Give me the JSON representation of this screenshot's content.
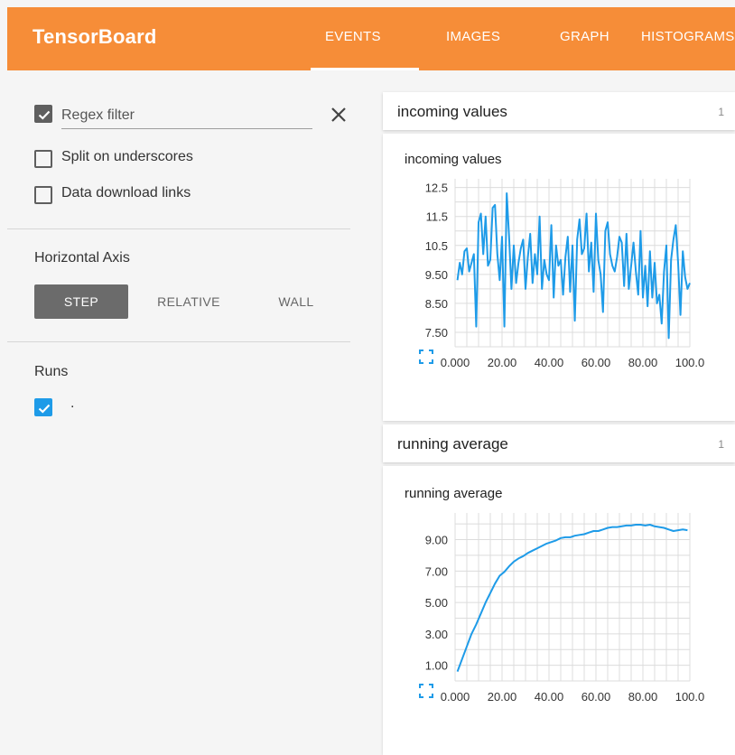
{
  "app": {
    "title": "TensorBoard",
    "tabs": [
      {
        "label": "EVENTS",
        "active": true
      },
      {
        "label": "IMAGES",
        "active": false
      },
      {
        "label": "GRAPH",
        "active": false
      },
      {
        "label": "HISTOGRAMS",
        "active": false
      }
    ],
    "accent_color": "#f68d38"
  },
  "sidebar": {
    "regex_filter": {
      "checked": true,
      "placeholder": "Regex filter",
      "value": ""
    },
    "split_underscores": {
      "label": "Split on underscores",
      "checked": false
    },
    "data_download": {
      "label": "Data download links",
      "checked": false
    },
    "horizontal_axis": {
      "title": "Horizontal Axis",
      "options": [
        "STEP",
        "RELATIVE",
        "WALL"
      ],
      "selected": "STEP"
    },
    "runs": {
      "title": "Runs",
      "items": [
        {
          "label": ".",
          "checked": true,
          "color": "#1e9be8"
        }
      ]
    }
  },
  "cards": [
    {
      "header": "incoming values",
      "count": "1",
      "chart_title": "incoming values"
    },
    {
      "header": "running average",
      "count": "1",
      "chart_title": "running average"
    }
  ],
  "chart_data": [
    {
      "type": "line",
      "title": "incoming values",
      "xlabel": "",
      "ylabel": "",
      "xlim": [
        0,
        100
      ],
      "ylim": [
        7.0,
        12.8
      ],
      "xticks": [
        "0.000",
        "20.00",
        "40.00",
        "60.00",
        "80.00",
        "100.0"
      ],
      "yticks": [
        "7.50",
        "8.50",
        "9.50",
        "10.5",
        "11.5",
        "12.5"
      ],
      "ytick_values": [
        7.5,
        8.5,
        9.5,
        10.5,
        11.5,
        12.5
      ],
      "grid": true,
      "series": [
        {
          "color": "#1e9be8",
          "x": [
            1,
            2,
            3,
            4,
            5,
            6,
            7,
            8,
            9,
            10,
            11,
            12,
            13,
            14,
            15,
            16,
            17,
            18,
            19,
            20,
            21,
            22,
            23,
            24,
            25,
            26,
            27,
            28,
            29,
            30,
            31,
            32,
            33,
            34,
            35,
            36,
            37,
            38,
            39,
            40,
            41,
            42,
            43,
            44,
            45,
            46,
            47,
            48,
            49,
            50,
            51,
            52,
            53,
            54,
            55,
            56,
            57,
            58,
            59,
            60,
            61,
            62,
            63,
            64,
            65,
            66,
            67,
            68,
            69,
            70,
            71,
            72,
            73,
            74,
            75,
            76,
            77,
            78,
            79,
            80,
            81,
            82,
            83,
            84,
            85,
            86,
            87,
            88,
            89,
            90,
            91,
            92,
            93,
            94,
            95,
            96,
            97,
            98,
            99,
            100
          ],
          "y": [
            9.3,
            9.9,
            9.5,
            10.3,
            10.4,
            9.6,
            9.9,
            10.2,
            7.7,
            11.3,
            11.6,
            10.2,
            11.5,
            9.8,
            10.0,
            11.8,
            11.9,
            10.2,
            9.3,
            10.8,
            7.7,
            12.3,
            10.8,
            9.0,
            10.5,
            9.2,
            9.9,
            10.4,
            10.7,
            9.0,
            10.1,
            10.9,
            9.2,
            10.2,
            9.5,
            11.5,
            9.0,
            10.0,
            9.5,
            9.3,
            11.2,
            8.7,
            10.5,
            9.8,
            10.0,
            8.8,
            10.1,
            10.8,
            8.9,
            10.5,
            7.9,
            10.7,
            11.4,
            10.2,
            10.4,
            11.6,
            9.6,
            10.6,
            8.9,
            11.6,
            10.0,
            9.5,
            8.2,
            11.0,
            11.3,
            10.2,
            9.8,
            9.6,
            10.1,
            10.8,
            10.6,
            9.1,
            10.9,
            9.0,
            9.8,
            10.6,
            9.6,
            8.8,
            11.0,
            8.7,
            9.8,
            8.4,
            10.3,
            8.7,
            9.9,
            8.5,
            8.8,
            7.8,
            9.6,
            10.5,
            7.3,
            10.0,
            10.7,
            11.2,
            9.9,
            8.1,
            10.3,
            9.4,
            9.0,
            9.2
          ]
        }
      ]
    },
    {
      "type": "line",
      "title": "running average",
      "xlabel": "",
      "ylabel": "",
      "xlim": [
        0,
        100
      ],
      "ylim": [
        0.0,
        10.7
      ],
      "xticks": [
        "0.000",
        "20.00",
        "40.00",
        "60.00",
        "80.00",
        "100.0"
      ],
      "yticks": [
        "1.00",
        "3.00",
        "5.00",
        "7.00",
        "9.00"
      ],
      "ytick_values": [
        1,
        3,
        5,
        7,
        9
      ],
      "grid": true,
      "series": [
        {
          "color": "#1e9be8",
          "x": [
            1,
            3,
            5,
            7,
            9,
            11,
            13,
            15,
            17,
            19,
            21,
            23,
            25,
            27,
            29,
            31,
            33,
            35,
            37,
            39,
            41,
            43,
            45,
            47,
            49,
            51,
            53,
            55,
            57,
            59,
            61,
            63,
            65,
            67,
            69,
            71,
            73,
            75,
            77,
            79,
            81,
            83,
            85,
            87,
            89,
            91,
            93,
            95,
            97,
            99
          ],
          "y": [
            0.6,
            1.4,
            2.2,
            3.0,
            3.6,
            4.3,
            5.0,
            5.6,
            6.2,
            6.7,
            6.95,
            7.3,
            7.6,
            7.8,
            7.95,
            8.15,
            8.3,
            8.45,
            8.6,
            8.75,
            8.85,
            8.95,
            9.1,
            9.15,
            9.15,
            9.25,
            9.3,
            9.35,
            9.45,
            9.55,
            9.55,
            9.65,
            9.75,
            9.8,
            9.8,
            9.85,
            9.9,
            9.9,
            9.95,
            9.95,
            9.9,
            9.95,
            9.85,
            9.8,
            9.75,
            9.65,
            9.55,
            9.6,
            9.65,
            9.6
          ]
        }
      ]
    }
  ]
}
